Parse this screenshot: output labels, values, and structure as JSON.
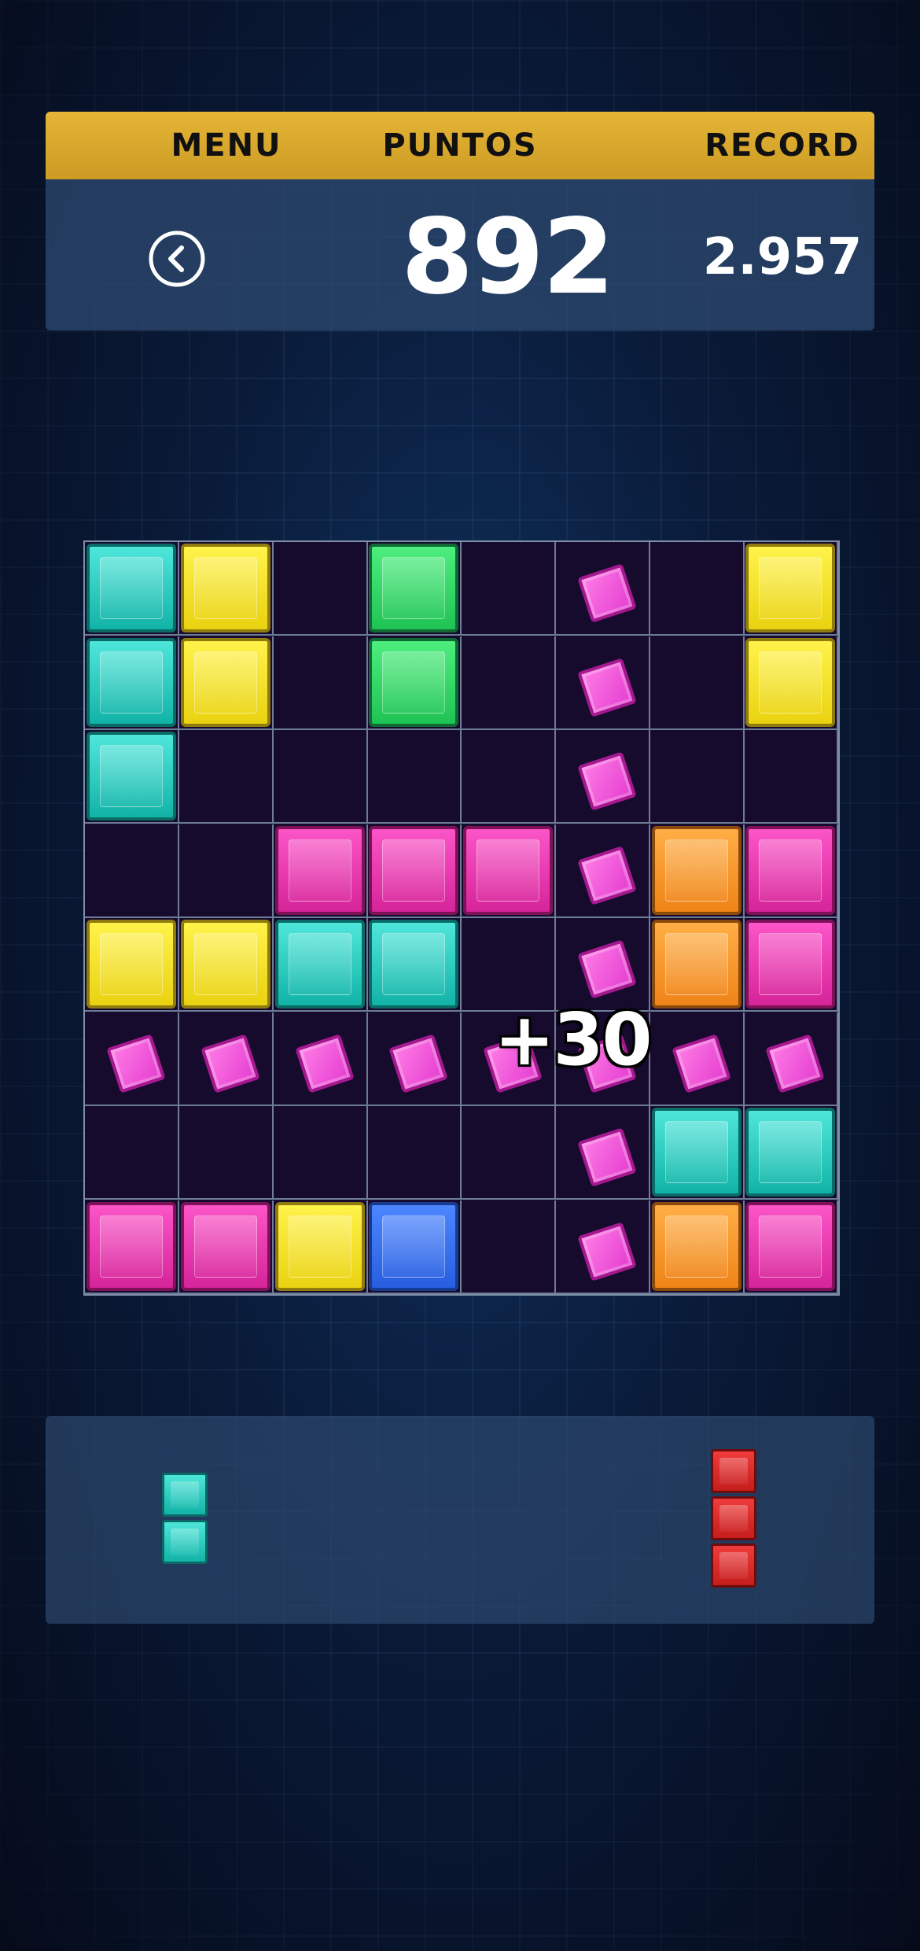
{
  "header": {
    "menu_label": "MENU",
    "score_label": "PUNTOS",
    "record_label": "RECORD",
    "score": "892",
    "record": "2.957",
    "back_icon": "chevron-left-circle-icon"
  },
  "board": {
    "rows": 8,
    "cols": 8,
    "cells": [
      [
        "cyan",
        "yellow",
        "empty",
        "green",
        "empty",
        "gem",
        "empty",
        "yellow"
      ],
      [
        "cyan",
        "yellow",
        "empty",
        "green",
        "empty",
        "gem",
        "empty",
        "yellow"
      ],
      [
        "cyan",
        "empty",
        "empty",
        "empty",
        "empty",
        "gem",
        "empty",
        "empty"
      ],
      [
        "empty",
        "empty",
        "magenta",
        "magenta",
        "magenta",
        "gem",
        "orange",
        "magenta"
      ],
      [
        "yellow",
        "yellow",
        "cyan",
        "cyan",
        "empty",
        "gem",
        "orange",
        "magenta"
      ],
      [
        "gem",
        "gem",
        "gem",
        "gem",
        "gem",
        "gem",
        "gem",
        "gem"
      ],
      [
        "empty",
        "empty",
        "empty",
        "empty",
        "empty",
        "gem",
        "cyan",
        "cyan"
      ],
      [
        "magenta",
        "magenta",
        "yellow",
        "blue",
        "empty",
        "gem",
        "orange",
        "magenta"
      ]
    ],
    "bonus_text": "+30"
  },
  "tray": {
    "pieces": [
      {
        "name": "tray-piece-cyan-vertical-2",
        "color": "cyan",
        "cells": 2
      },
      {
        "name": "tray-piece-red-vertical-3",
        "color": "red",
        "cells": 3
      }
    ]
  },
  "colors": {
    "cyan": "#2bcfc2",
    "yellow": "#f5e22b",
    "green": "#33d865",
    "magenta": "#ea3ab3",
    "orange": "#f79a2e",
    "blue": "#3a72f0",
    "red": "#dd2c2c",
    "gem": "#f25ddb",
    "header_bar": "#dcaa2e"
  }
}
